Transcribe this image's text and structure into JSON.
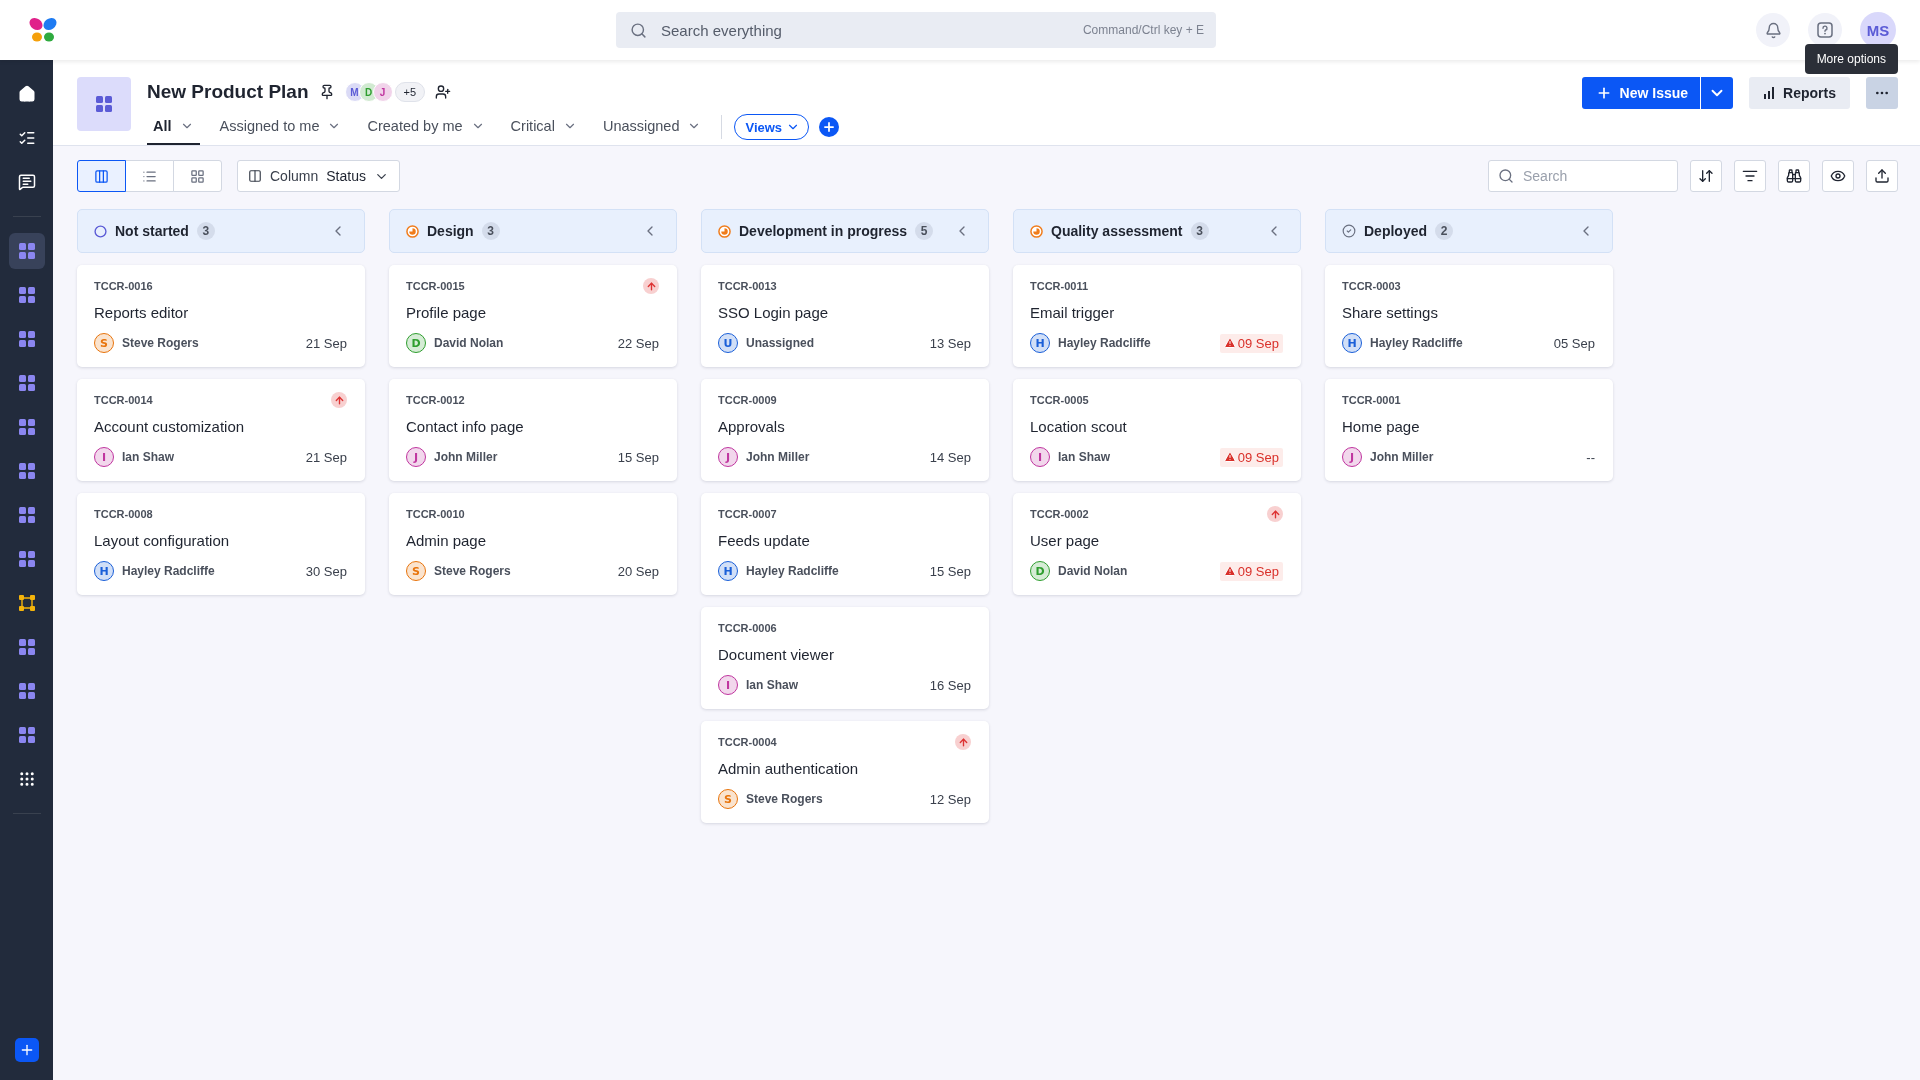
{
  "app": {
    "search_placeholder": "Search everything",
    "search_shortcut": "Command/Ctrl key + E",
    "user_initials": "MS"
  },
  "sidebar": {
    "items": [
      {
        "kind": "home",
        "selected": false
      },
      {
        "kind": "tasks",
        "selected": false
      },
      {
        "kind": "chat",
        "selected": false
      },
      {
        "kind": "grid",
        "selected": true
      },
      {
        "kind": "grid",
        "selected": false
      },
      {
        "kind": "grid",
        "selected": false
      },
      {
        "kind": "grid",
        "selected": false
      },
      {
        "kind": "grid",
        "selected": false
      },
      {
        "kind": "grid",
        "selected": false
      },
      {
        "kind": "grid",
        "selected": false
      },
      {
        "kind": "grid",
        "selected": false
      },
      {
        "kind": "network",
        "selected": false
      },
      {
        "kind": "grid",
        "selected": false
      },
      {
        "kind": "grid",
        "selected": false
      },
      {
        "kind": "grid",
        "selected": false
      },
      {
        "kind": "apps",
        "selected": false
      }
    ]
  },
  "project": {
    "title": "New Product Plan",
    "members": [
      {
        "initials": "M",
        "color": "#5b5bd6"
      },
      {
        "initials": "D",
        "color": "#2f9e2f"
      },
      {
        "initials": "J",
        "color": "#c0359f"
      }
    ],
    "more_members": "+5"
  },
  "filter_tabs": [
    {
      "label": "All",
      "selected": true
    },
    {
      "label": "Assigned to me",
      "selected": false
    },
    {
      "label": "Created by me",
      "selected": false
    },
    {
      "label": "Critical",
      "selected": false
    },
    {
      "label": "Unassigned",
      "selected": false
    }
  ],
  "views_button": "Views",
  "actions": {
    "new_issue": "New Issue",
    "reports": "Reports",
    "tooltip": "More options"
  },
  "toolbar": {
    "view_modes": [
      {
        "kind": "board",
        "selected": true
      },
      {
        "kind": "list",
        "selected": false
      },
      {
        "kind": "grid",
        "selected": false
      }
    ],
    "group_label": "Column",
    "group_value": "Status",
    "search_placeholder": "Search"
  },
  "columns": [
    {
      "title": "Not started",
      "count": "3",
      "kind": "open",
      "cards": [
        {
          "id": "TCCR-0016",
          "title": "Reports editor",
          "assignee": "Steve Rogers",
          "initial": "S",
          "color": "#e8740c",
          "due": "21 Sep",
          "overdue": false,
          "high_priority": false
        },
        {
          "id": "TCCR-0014",
          "title": "Account customization",
          "assignee": "Ian Shaw",
          "initial": "I",
          "color": "#c0359f",
          "due": "21 Sep",
          "overdue": false,
          "high_priority": true
        },
        {
          "id": "TCCR-0008",
          "title": "Layout configuration",
          "assignee": "Hayley Radcliffe",
          "initial": "H",
          "color": "#1a5fd8",
          "due": "30 Sep",
          "overdue": false,
          "high_priority": false
        }
      ]
    },
    {
      "title": "Design",
      "count": "3",
      "kind": "progress",
      "cards": [
        {
          "id": "TCCR-0015",
          "title": "Profile page",
          "assignee": "David Nolan",
          "initial": "D",
          "color": "#2f9e2f",
          "due": "22 Sep",
          "overdue": false,
          "high_priority": true
        },
        {
          "id": "TCCR-0012",
          "title": "Contact info page",
          "assignee": "John Miller",
          "initial": "J",
          "color": "#c0359f",
          "due": "15 Sep",
          "overdue": false,
          "high_priority": false
        },
        {
          "id": "TCCR-0010",
          "title": "Admin page",
          "assignee": "Steve Rogers",
          "initial": "S",
          "color": "#e8740c",
          "due": "20 Sep",
          "overdue": false,
          "high_priority": false
        }
      ]
    },
    {
      "title": "Development in progress",
      "count": "5",
      "kind": "progress",
      "cards": [
        {
          "id": "TCCR-0013",
          "title": "SSO Login page",
          "assignee": "Unassigned",
          "initial": "U",
          "color": "#1a5fd8",
          "due": "13 Sep",
          "overdue": false,
          "high_priority": false
        },
        {
          "id": "TCCR-0009",
          "title": "Approvals",
          "assignee": "John Miller",
          "initial": "J",
          "color": "#c0359f",
          "due": "14 Sep",
          "overdue": false,
          "high_priority": false
        },
        {
          "id": "TCCR-0007",
          "title": "Feeds update",
          "assignee": "Hayley Radcliffe",
          "initial": "H",
          "color": "#1a5fd8",
          "due": "15 Sep",
          "overdue": false,
          "high_priority": false
        },
        {
          "id": "TCCR-0006",
          "title": "Document viewer",
          "assignee": "Ian Shaw",
          "initial": "I",
          "color": "#c0359f",
          "due": "16 Sep",
          "overdue": false,
          "high_priority": false
        },
        {
          "id": "TCCR-0004",
          "title": "Admin authentication",
          "assignee": "Steve Rogers",
          "initial": "S",
          "color": "#e8740c",
          "due": "12 Sep",
          "overdue": false,
          "high_priority": true
        }
      ]
    },
    {
      "title": "Quality assessment",
      "count": "3",
      "kind": "progress",
      "cards": [
        {
          "id": "TCCR-0011",
          "title": "Email trigger",
          "assignee": "Hayley Radcliffe",
          "initial": "H",
          "color": "#1a5fd8",
          "due": "09 Sep",
          "overdue": true,
          "high_priority": false
        },
        {
          "id": "TCCR-0005",
          "title": "Location scout",
          "assignee": "Ian Shaw",
          "initial": "I",
          "color": "#c0359f",
          "due": "09 Sep",
          "overdue": true,
          "high_priority": false
        },
        {
          "id": "TCCR-0002",
          "title": "User page",
          "assignee": "David Nolan",
          "initial": "D",
          "color": "#2f9e2f",
          "due": "09 Sep",
          "overdue": true,
          "high_priority": true
        }
      ]
    },
    {
      "title": "Deployed",
      "count": "2",
      "kind": "done",
      "cards": [
        {
          "id": "TCCR-0003",
          "title": "Share settings",
          "assignee": "Hayley Radcliffe",
          "initial": "H",
          "color": "#1a5fd8",
          "due": "05 Sep",
          "overdue": false,
          "high_priority": false
        },
        {
          "id": "TCCR-0001",
          "title": "Home page",
          "assignee": "John Miller",
          "initial": "J",
          "color": "#c0359f",
          "due": "--",
          "overdue": false,
          "high_priority": false
        }
      ]
    }
  ]
}
